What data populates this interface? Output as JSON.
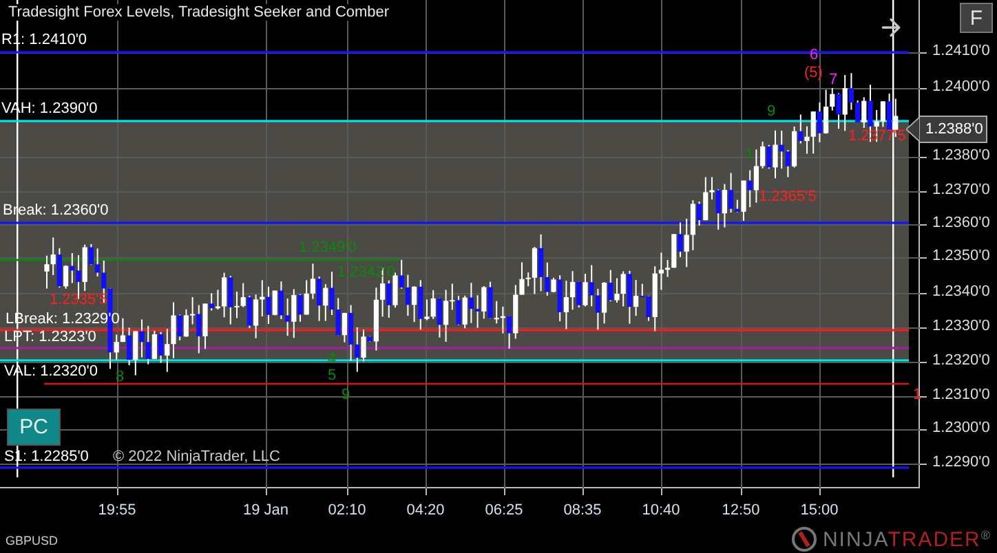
{
  "title": "Tradesight Forex Levels, Tradesight Seeker and Comber",
  "corner_button": "F",
  "levels": [
    {
      "label": "R1: 1.2410'0",
      "color": "#1414ff"
    },
    {
      "label": "VAH: 1.2390'0",
      "color": "#00e5e5"
    },
    {
      "label": "Break: 1.2360'0",
      "color": "#1414ff"
    },
    {
      "label": "LBreak: 1.2329'0",
      "color": "#ff1a1a"
    },
    {
      "label": "LPT: 1.2323'0",
      "color": "#a020a0"
    },
    {
      "label": "VAL: 1.2320'0",
      "color": "#00e5e5"
    },
    {
      "label": "S1: 1.2285'0",
      "color": "#1414ff"
    }
  ],
  "markers": [
    {
      "text": "1.2349'0",
      "color": "#0a8a0a"
    },
    {
      "text": "1.2342'0",
      "color": "#0a8a0a"
    },
    {
      "text": "1.2335'5",
      "color": "#ff2020"
    },
    {
      "text": "1.2365'5",
      "color": "#ff2020"
    },
    {
      "text": "1.2377'5",
      "color": "#ff2020"
    },
    {
      "text": "1",
      "color": "#ff2020"
    },
    {
      "text": "6",
      "color": "#ff20ff"
    },
    {
      "text": "(5)",
      "color": "#ff2020"
    },
    {
      "text": "7",
      "color": "#ff20ff"
    },
    {
      "text": "9",
      "color": "#0a8a0a"
    },
    {
      "text": "8",
      "color": "#0a8a0a"
    },
    {
      "text": "9",
      "color": "#0a8a0a"
    },
    {
      "text": "4",
      "color": "#0a8a0a"
    },
    {
      "text": "5",
      "color": "#0a8a0a"
    },
    {
      "text": "1",
      "color": "#0a8a0a"
    }
  ],
  "pc_button": "PC",
  "copyright": "© 2022 NinjaTrader, LLC",
  "price_ticks": [
    "1.2410'0",
    "1.2400'0",
    "1.2380'0",
    "1.2370'0",
    "1.2360'0",
    "1.2350'0",
    "1.2340'0",
    "1.2330'0",
    "1.2320'0",
    "1.2310'0",
    "1.2300'0",
    "1.2290'0"
  ],
  "current_price": "1.2388'0",
  "time_ticks": [
    "19:55",
    "19 Jan",
    "02:10",
    "04:20",
    "06:25",
    "08:35",
    "10:40",
    "12:50",
    "15:00"
  ],
  "instrument": "GBPUSD",
  "logo": {
    "part_1": "NINJA",
    "part_2": "TRADER",
    "mark": "®"
  }
}
